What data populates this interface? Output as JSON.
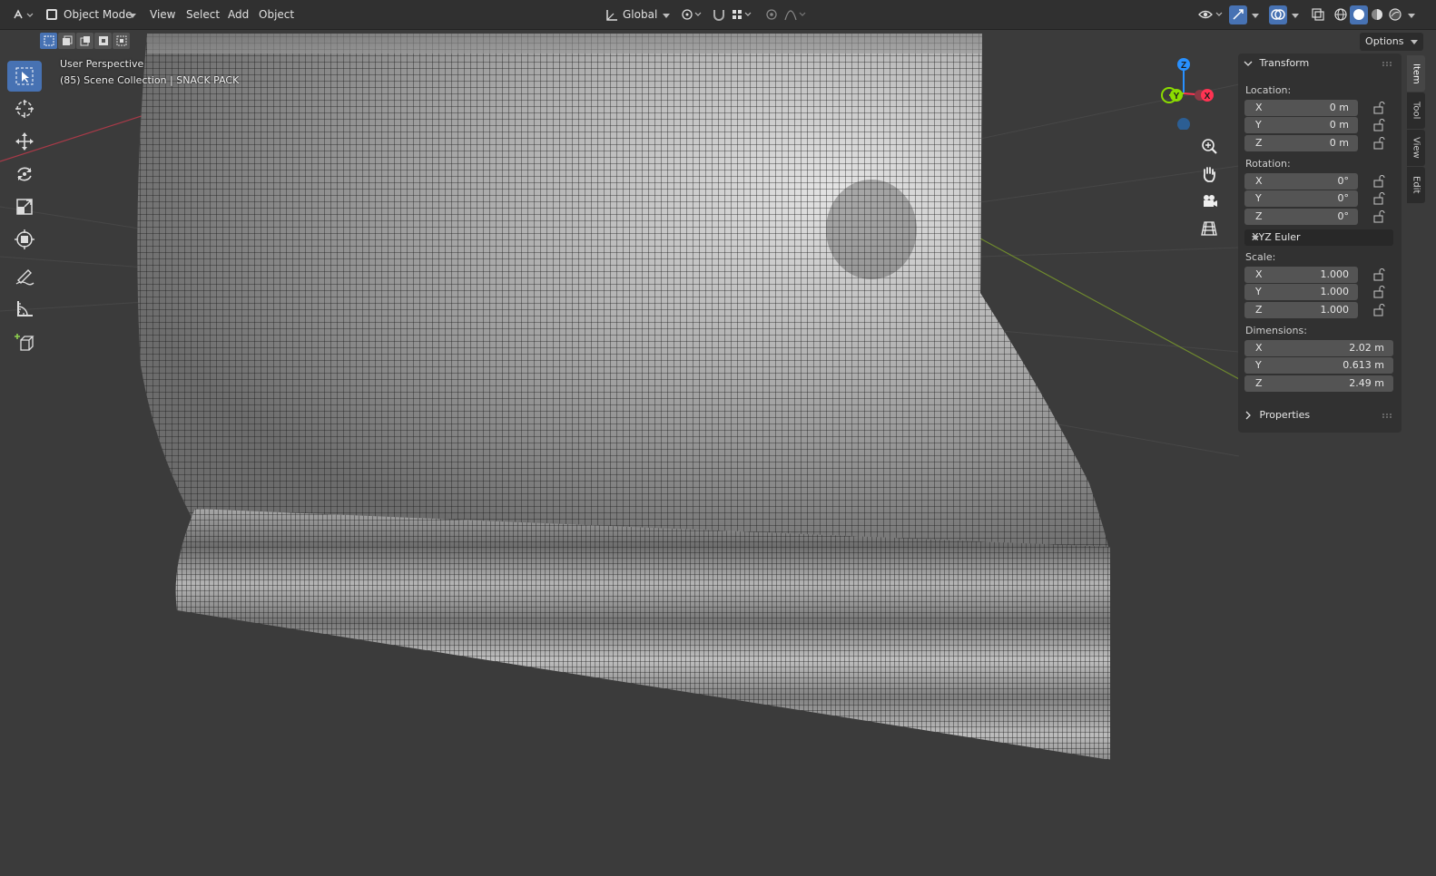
{
  "header": {
    "mode_label": "Object Mode",
    "menus": [
      "View",
      "Select",
      "Add",
      "Object"
    ],
    "orientation_label": "Global"
  },
  "viewport": {
    "view_label": "User Perspective",
    "collection_label": "(85) Scene Collection | SNACK PACK",
    "options_label": "Options"
  },
  "npanel": {
    "transform_label": "Transform",
    "location_label": "Location:",
    "location": [
      {
        "axis": "X",
        "value": "0 m"
      },
      {
        "axis": "Y",
        "value": "0 m"
      },
      {
        "axis": "Z",
        "value": "0 m"
      }
    ],
    "rotation_label": "Rotation:",
    "rotation": [
      {
        "axis": "X",
        "value": "0°"
      },
      {
        "axis": "Y",
        "value": "0°"
      },
      {
        "axis": "Z",
        "value": "0°"
      }
    ],
    "rotation_mode": "XYZ Euler",
    "scale_label": "Scale:",
    "scale": [
      {
        "axis": "X",
        "value": "1.000"
      },
      {
        "axis": "Y",
        "value": "1.000"
      },
      {
        "axis": "Z",
        "value": "1.000"
      }
    ],
    "dimensions_label": "Dimensions:",
    "dimensions": [
      {
        "axis": "X",
        "value": "2.02 m"
      },
      {
        "axis": "Y",
        "value": "0.613 m"
      },
      {
        "axis": "Z",
        "value": "2.49 m"
      }
    ],
    "properties_label": "Properties"
  },
  "sidebar_tabs": [
    "Item",
    "Tool",
    "View",
    "Edit"
  ],
  "gizmo": {
    "x_label": "X",
    "y_label": "Y",
    "z_label": "Z"
  },
  "colors": {
    "accent": "#4772b3",
    "axis_x": "#ff3352",
    "axis_y": "#8bdc00",
    "axis_z": "#2890ff"
  }
}
